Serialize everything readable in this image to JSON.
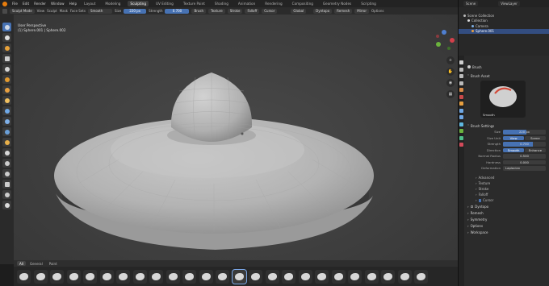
{
  "menubar": {
    "items": [
      "File",
      "Edit",
      "Render",
      "Window",
      "Help"
    ],
    "workspaces": [
      "Layout",
      "Modeling",
      "Sculpting",
      "UV Editing",
      "Texture Paint",
      "Shading",
      "Animation",
      "Rendering",
      "Compositing",
      "Geometry Nodes",
      "Scripting"
    ],
    "active_workspace": "Sculpting"
  },
  "right_header": {
    "scene": "Scene",
    "view_layer": "ViewLayer"
  },
  "toolheader": {
    "mode": "Sculpt Mode",
    "menus": [
      "View",
      "Sculpt",
      "Mask",
      "Face Sets"
    ],
    "brush_name": "Smooth",
    "size_label": "Size",
    "size_value": "220 px",
    "strength_label": "Strength",
    "strength_value": "0.700",
    "buttons": [
      "Brush",
      "Texture",
      "Stroke",
      "Falloff",
      "Cursor"
    ],
    "right_menus": [
      "Dyntopo",
      "Remesh",
      "Mirror"
    ],
    "options": "Options",
    "orient": "Global"
  },
  "viewport": {
    "perspective": "User Perspective",
    "object_label": "(1) Sphere.001 | Sphere.002"
  },
  "shelf": {
    "tabs": [
      "All",
      "General",
      "Paint"
    ],
    "active_tab": "All"
  },
  "outliner": {
    "rows": [
      {
        "label": "Scene Collection",
        "indent": 0,
        "selected": false
      },
      {
        "label": "Collection",
        "indent": 1,
        "selected": false
      },
      {
        "label": "Camera",
        "indent": 2,
        "selected": false
      },
      {
        "label": "Sphere.001",
        "indent": 2,
        "selected": true
      }
    ]
  },
  "properties": {
    "panel_title": "Brush",
    "brush_asset": "Brush Asset",
    "preview_name": "Smooth",
    "brush_settings": "Brush Settings",
    "rows": [
      {
        "label": "Size",
        "value": "220 px",
        "fill": 0.55
      },
      {
        "label": "Size Unit",
        "type": "seg",
        "options": [
          "View",
          "Scene"
        ],
        "active": 0
      },
      {
        "label": "Strength",
        "value": "0.700",
        "fill": 0.7
      },
      {
        "label": "Direction",
        "type": "seg",
        "options": [
          "Smooth",
          "Enhance"
        ],
        "active": 0
      },
      {
        "label": "Normal Radius",
        "value": "0.500",
        "fill": 0
      },
      {
        "label": "Hardness",
        "value": "0.000",
        "fill": 0
      },
      {
        "label": "Deformation",
        "value": "Laplacian",
        "fill": 0
      }
    ],
    "subsections": [
      "Advanced",
      "Texture",
      "Stroke",
      "Falloff",
      "Cursor"
    ],
    "sections": [
      "Dyntopo",
      "Remesh",
      "Symmetry",
      "Options",
      "Workspace"
    ]
  },
  "colors": {
    "accent": "#4772b3",
    "brand": "#e87d0d"
  }
}
